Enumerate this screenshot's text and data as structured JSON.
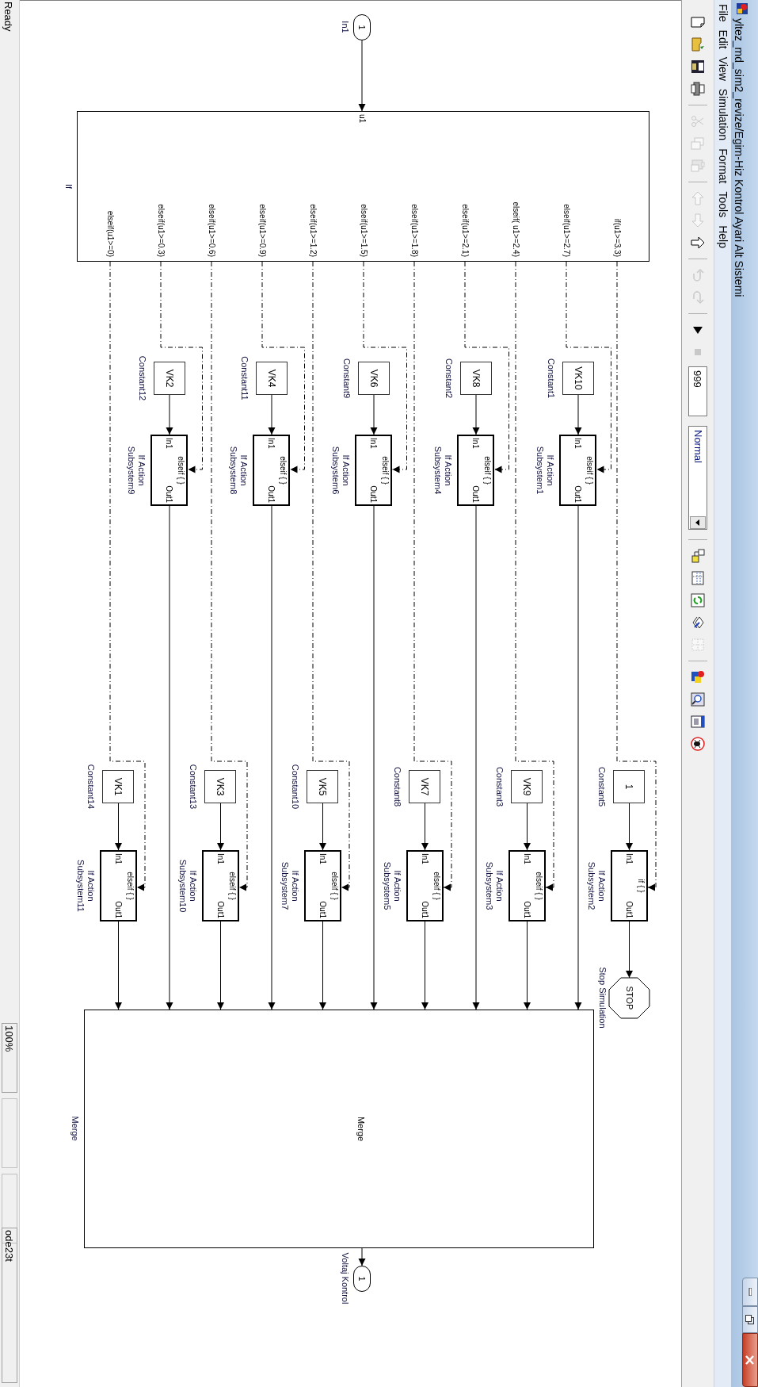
{
  "window": {
    "title": "yltez_md_sim2_revize/Egim-Hiz Kontrol Ayari Alt Sistemi"
  },
  "menu": [
    {
      "label": "File"
    },
    {
      "label": "Edit"
    },
    {
      "label": "View"
    },
    {
      "label": "Simulation"
    },
    {
      "label": "Format"
    },
    {
      "label": "Tools"
    },
    {
      "label": "Help"
    }
  ],
  "toolbar": [
    {
      "kind": "new",
      "disabled": false
    },
    {
      "kind": "open",
      "disabled": false
    },
    {
      "kind": "save",
      "disabled": false
    },
    {
      "kind": "print",
      "disabled": false
    },
    {
      "kind": "separator"
    },
    {
      "kind": "cut",
      "disabled": true
    },
    {
      "kind": "copy",
      "disabled": true
    },
    {
      "kind": "paste",
      "disabled": true
    },
    {
      "kind": "separator"
    },
    {
      "kind": "back",
      "disabled": true
    },
    {
      "kind": "forward",
      "disabled": true
    },
    {
      "kind": "up",
      "disabled": false
    },
    {
      "kind": "separator"
    },
    {
      "kind": "undo",
      "disabled": true
    },
    {
      "kind": "redo",
      "disabled": true
    },
    {
      "kind": "separator"
    },
    {
      "kind": "start",
      "disabled": false
    },
    {
      "kind": "stop",
      "disabled": true
    },
    {
      "kind": "stop_time",
      "value": "999"
    },
    {
      "kind": "mode",
      "value": "Normal"
    },
    {
      "kind": "separator"
    },
    {
      "kind": "library",
      "disabled": false
    },
    {
      "kind": "explorer",
      "disabled": false
    },
    {
      "kind": "refresh",
      "disabled": false
    },
    {
      "kind": "layers",
      "disabled": false
    },
    {
      "kind": "grid",
      "disabled": true
    },
    {
      "kind": "separator"
    },
    {
      "kind": "build",
      "disabled": false
    },
    {
      "kind": "inspect",
      "disabled": false
    },
    {
      "kind": "panel",
      "disabled": false
    },
    {
      "kind": "debug",
      "disabled": false
    }
  ],
  "diagram": {
    "inport": {
      "number": "1",
      "label": "In1"
    },
    "if_block": {
      "input": "u1",
      "label": "If"
    },
    "branches": [
      {
        "condition": "if(u1>=3.3)",
        "constant_value": "1",
        "constant_name": "Constant5",
        "action": "if { }",
        "port_in": "In1",
        "port_out": "Out1",
        "subsystem_label": [
          "If Action",
          "Subsystem2"
        ],
        "kind": "stop"
      },
      {
        "condition": "elseif(u1>=2.7)",
        "constant_value": "VK10",
        "constant_name": "Constant1",
        "action": "elseif { }",
        "port_in": "In1",
        "port_out": "Out1",
        "subsystem_label": [
          "If Action",
          "Subsystem1"
        ],
        "kind": "merge"
      },
      {
        "condition": "elseif( u1>=2.4)",
        "constant_value": "VK9",
        "constant_name": "Constant3",
        "action": "elseif { }",
        "port_in": "In1",
        "port_out": "Out1",
        "subsystem_label": [
          "If Action",
          "Subsystem3"
        ],
        "kind": "merge"
      },
      {
        "condition": "elseif(u1>=2.1)",
        "constant_value": "VK8",
        "constant_name": "Constant2",
        "action": "elseif { }",
        "port_in": "In1",
        "port_out": "Out1",
        "subsystem_label": [
          "If Action",
          "Subsystem4"
        ],
        "kind": "merge"
      },
      {
        "condition": "elseif(u1>=1.8)",
        "constant_value": "VK7",
        "constant_name": "Constant8",
        "action": "elseif { }",
        "port_in": "In1",
        "port_out": "Out1",
        "subsystem_label": [
          "If Action",
          "Subsystem5"
        ],
        "kind": "merge"
      },
      {
        "condition": "elseif(u1>=1.5)",
        "constant_value": "VK6",
        "constant_name": "Constant9",
        "action": "elseif { }",
        "port_in": "In1",
        "port_out": "Out1",
        "subsystem_label": [
          "If Action",
          "Subsystem6"
        ],
        "kind": "merge"
      },
      {
        "condition": "elseif(u1>=1.2)",
        "constant_value": "VK5",
        "constant_name": "Constant10",
        "action": "elseif { }",
        "port_in": "In1",
        "port_out": "Out1",
        "subsystem_label": [
          "If Action",
          "Subsystem7"
        ],
        "kind": "merge"
      },
      {
        "condition": "elseif(u1>=0.9)",
        "constant_value": "VK4",
        "constant_name": "Constant11",
        "action": "elseif { }",
        "port_in": "In1",
        "port_out": "Out1",
        "subsystem_label": [
          "If Action",
          "Subsystem8"
        ],
        "kind": "merge"
      },
      {
        "condition": "elseif(u1>=0.6)",
        "constant_value": "VK3",
        "constant_name": "Constant13",
        "action": "elseif { }",
        "port_in": "In1",
        "port_out": "Out1",
        "subsystem_label": [
          "If Action",
          "Subsystem10"
        ],
        "kind": "merge"
      },
      {
        "condition": "elseif(u1>=0.3)",
        "constant_value": "VK2",
        "constant_name": "Constant12",
        "action": "elseif { }",
        "port_in": "In1",
        "port_out": "Out1",
        "subsystem_label": [
          "If Action",
          "Subsystem9"
        ],
        "kind": "merge"
      },
      {
        "condition": "elseif(u1>=0)",
        "constant_value": "VK1",
        "constant_name": "Constant14",
        "action": "elseif { }",
        "port_in": "In1",
        "port_out": "Out1",
        "subsystem_label": [
          "If Action",
          "Subsystem11"
        ],
        "kind": "merge"
      }
    ],
    "stop": {
      "text": "STOP",
      "label": "Stop Simulation"
    },
    "merge": {
      "text": "Merge",
      "label": "Merge"
    },
    "outport": {
      "number": "1",
      "label": "Voltaj Kontrol"
    }
  },
  "status_bar": {
    "state": "Ready",
    "zoom": "100%",
    "solver": "ode23t"
  }
}
